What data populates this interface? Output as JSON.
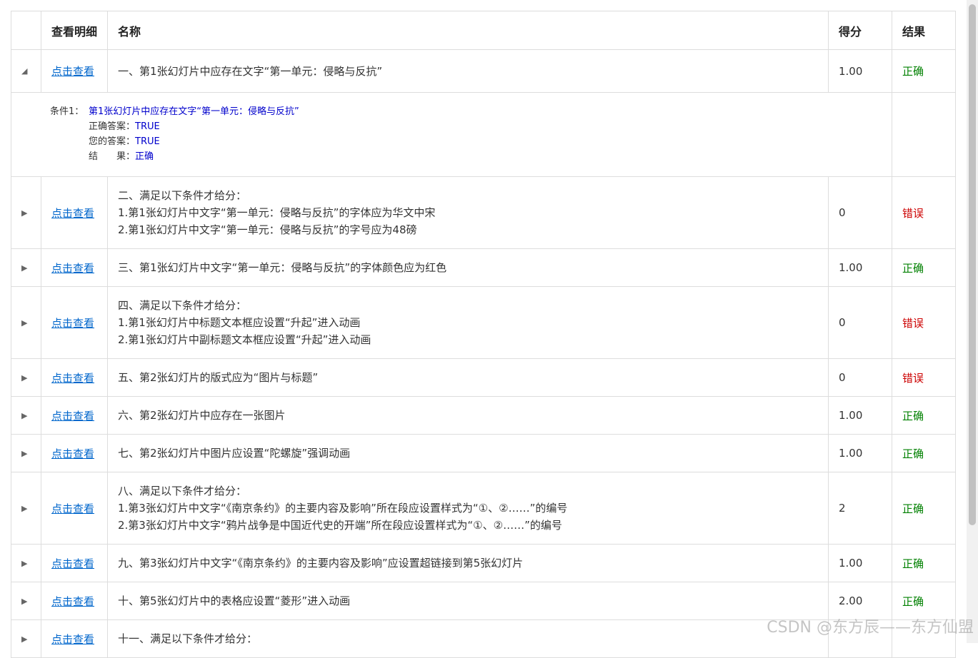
{
  "headers": {
    "detail": "查看明细",
    "name": "名称",
    "score": "得分",
    "result": "结果"
  },
  "view_label": "点击查看",
  "rows": [
    {
      "lines": [
        "一、第1张幻灯片中应存在文字“第一单元：侵略与反抗”"
      ],
      "score": "1.00",
      "result": "正确",
      "expanded": true
    },
    {
      "lines": [
        "二、满足以下条件才给分：",
        "1.第1张幻灯片中文字“第一单元：侵略与反抗”的字体应为华文中宋",
        "2.第1张幻灯片中文字“第一单元：侵略与反抗”的字号应为48磅"
      ],
      "score": "0",
      "result": "错误"
    },
    {
      "lines": [
        "三、第1张幻灯片中文字“第一单元：侵略与反抗”的字体颜色应为红色"
      ],
      "score": "1.00",
      "result": "正确"
    },
    {
      "lines": [
        "四、满足以下条件才给分：",
        "1.第1张幻灯片中标题文本框应设置“升起”进入动画",
        "2.第1张幻灯片中副标题文本框应设置“升起”进入动画"
      ],
      "score": "0",
      "result": "错误"
    },
    {
      "lines": [
        "五、第2张幻灯片的版式应为“图片与标题”"
      ],
      "score": "0",
      "result": "错误"
    },
    {
      "lines": [
        "六、第2张幻灯片中应存在一张图片"
      ],
      "score": "1.00",
      "result": "正确"
    },
    {
      "lines": [
        "七、第2张幻灯片中图片应设置“陀螺旋”强调动画"
      ],
      "score": "1.00",
      "result": "正确"
    },
    {
      "lines": [
        "八、满足以下条件才给分：",
        "1.第3张幻灯片中文字“《南京条约》的主要内容及影响”所在段应设置样式为“①、②……”的编号",
        "2.第3张幻灯片中文字“鸦片战争是中国近代史的开端”所在段应设置样式为“①、②……”的编号"
      ],
      "score": "2",
      "result": "正确"
    },
    {
      "lines": [
        "九、第3张幻灯片中文字“《南京条约》的主要内容及影响”应设置超链接到第5张幻灯片"
      ],
      "score": "1.00",
      "result": "正确"
    },
    {
      "lines": [
        "十、第5张幻灯片中的表格应设置“菱形”进入动画"
      ],
      "score": "2.00",
      "result": "正确"
    },
    {
      "lines": [
        "十一、满足以下条件才给分："
      ],
      "score": "",
      "result": ""
    }
  ],
  "detail": {
    "cond_label": "条件1：",
    "cond_text": "第1张幻灯片中应存在文字“第一单元：侵略与反抗”",
    "correct_label": "正确答案：",
    "correct_value": "TRUE",
    "your_label": "您的答案：",
    "your_value": "TRUE",
    "result_label": "结　　果：",
    "result_value": "正确"
  },
  "watermark": "CSDN @东方辰——东方仙盟",
  "colors": {
    "ok": "#008000",
    "err": "#cc0000",
    "link": "#0066cc"
  }
}
